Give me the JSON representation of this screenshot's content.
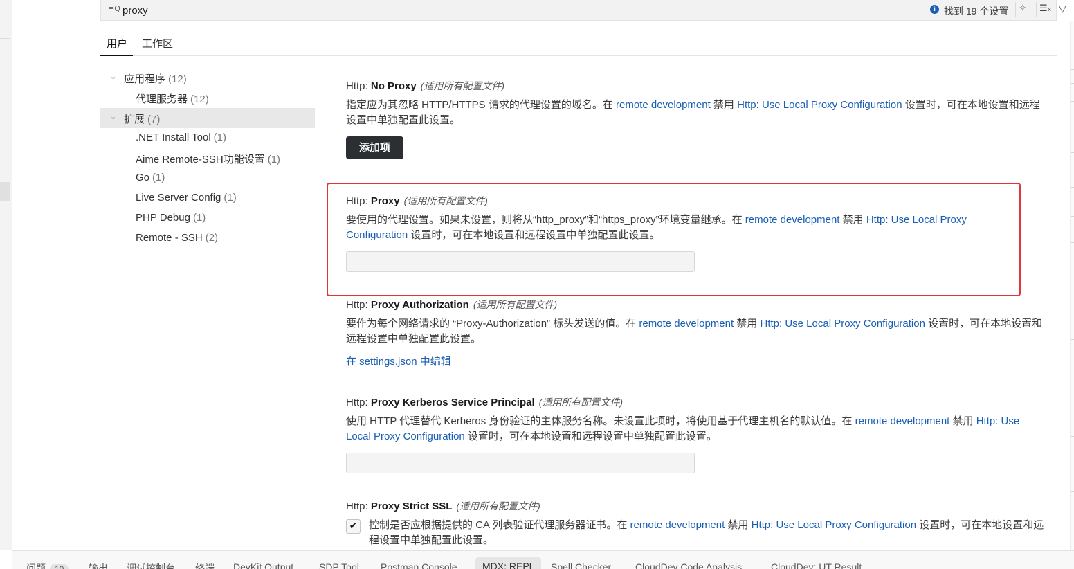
{
  "search": {
    "query": "proxy",
    "result_count": "找到 19 个设置",
    "icons": [
      "search-icon",
      "info-icon",
      "sparkle-icon",
      "clear-filter-icon",
      "filter-icon"
    ]
  },
  "scope_tabs": [
    {
      "label": "用户",
      "active": true
    },
    {
      "label": "工作区",
      "active": false
    }
  ],
  "tree": [
    {
      "label": "应用程序",
      "count": "(12)",
      "level": 0,
      "expanded": true
    },
    {
      "label": "代理服务器",
      "count": "(12)",
      "level": 1
    },
    {
      "label": "扩展",
      "count": "(7)",
      "level": 0,
      "expanded": true,
      "selected": true
    },
    {
      "label": ".NET Install Tool",
      "count": "(1)",
      "level": 1
    },
    {
      "label": "Aime Remote-SSH功能设置",
      "count": "(1)",
      "level": 1
    },
    {
      "label": "Go",
      "count": "(1)",
      "level": 1
    },
    {
      "label": "Live Server Config",
      "count": "(1)",
      "level": 1
    },
    {
      "label": "PHP Debug",
      "count": "(1)",
      "level": 1
    },
    {
      "label": "Remote - SSH",
      "count": "(2)",
      "level": 1
    }
  ],
  "settings": {
    "no_proxy": {
      "category": "Http: ",
      "name": "No Proxy",
      "scope": "(适用所有配置文件)",
      "desc_a": "指定应为其忽略 HTTP/HTTPS 请求的代理设置的域名。在 ",
      "link_a": "remote development",
      "desc_b": " 禁用 ",
      "link_b": "Http: Use Local Proxy Configuration",
      "desc_c": " 设置时，可在本地设置和远程设置中单独配置此设置。",
      "button": "添加项"
    },
    "proxy": {
      "category": "Http: ",
      "name": "Proxy",
      "scope": "(适用所有配置文件)",
      "desc_a": "要使用的代理设置。如果未设置，则将从“http_proxy”和“https_proxy”环境变量继承。在 ",
      "link_a": "remote development",
      "desc_b": " 禁用 ",
      "link_b": "Http: Use Local Proxy Configuration",
      "desc_c": " 设置时，可在本地设置和远程设置中单独配置此设置。",
      "value": ""
    },
    "proxy_authorization": {
      "category": "Http: ",
      "name": "Proxy Authorization",
      "scope": "(适用所有配置文件)",
      "desc_a": "要作为每个网络请求的 “Proxy-Authorization” 标头发送的值。在 ",
      "link_a": "remote development",
      "desc_b": " 禁用 ",
      "link_b": "Http: Use Local Proxy Configuration",
      "desc_c": " 设置时，可在本地设置和远程设置中单独配置此设置。",
      "edit_link": "在 settings.json 中编辑"
    },
    "proxy_kerberos": {
      "category": "Http: ",
      "name": "Proxy Kerberos Service Principal",
      "scope": "(适用所有配置文件)",
      "desc_a": "使用 HTTP 代理替代 Kerberos 身份验证的主体服务名称。未设置此项时，将使用基于代理主机名的默认值。在 ",
      "link_a": "remote development",
      "desc_b": " 禁用 ",
      "link_b": "Http: Use Local Proxy Configuration",
      "desc_c": " 设置时，可在本地设置和远程设置中单独配置此设置。",
      "value": ""
    },
    "proxy_strict_ssl": {
      "category": "Http: ",
      "name": "Proxy Strict SSL",
      "scope": "(适用所有配置文件)",
      "checked": true,
      "check_glyph": "✔",
      "desc_a": "控制是否应根据提供的 CA 列表验证代理服务器证书。在 ",
      "link_a": "remote development",
      "desc_b": " 禁用 ",
      "link_b": "Http: Use Local Proxy Configuration",
      "desc_c": " 设置时，可在本地设置和远程设置中单独配置此设置。"
    }
  },
  "panel_tabs": [
    {
      "label": "问题",
      "badge": "10"
    },
    {
      "label": "输出"
    },
    {
      "label": "调试控制台"
    },
    {
      "label": "终端"
    },
    {
      "label": "DevKit Output"
    },
    {
      "label": "SDP Tool"
    },
    {
      "label": "Postman Console"
    },
    {
      "label": "MDX: REPL",
      "active": true
    },
    {
      "label": "Spell Checker"
    },
    {
      "label": "CloudDev Code Analysis"
    },
    {
      "label": "CloudDev: UT Result"
    }
  ],
  "colors": {
    "link": "#1a5fb4",
    "highlight_border": "#e0363a",
    "button_bg": "#2b2f33"
  }
}
